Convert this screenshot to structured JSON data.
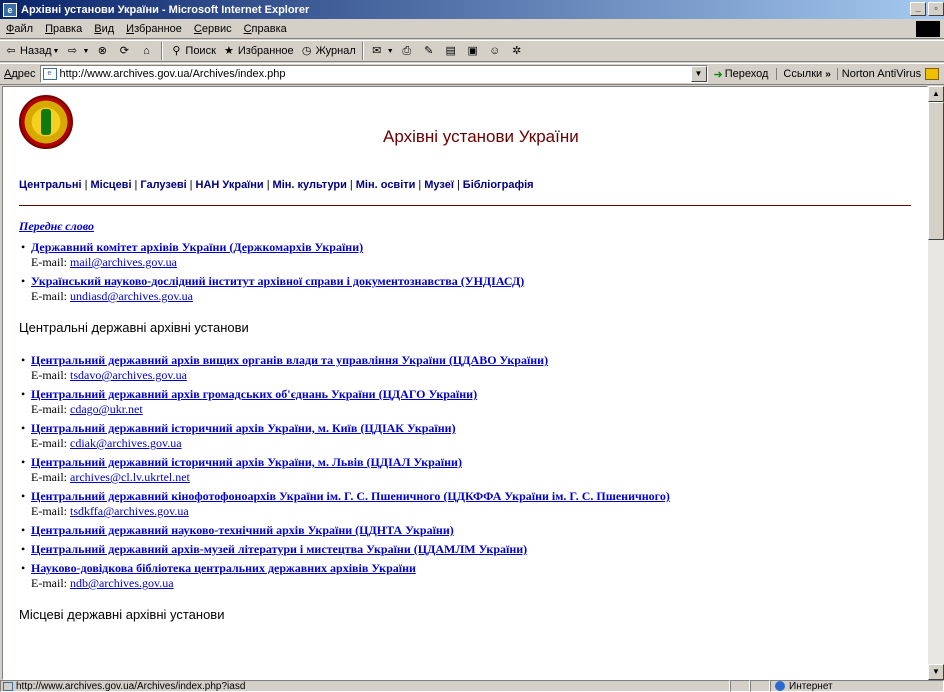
{
  "window": {
    "title": "Архівні установи України - Microsoft Internet Explorer"
  },
  "menu": [
    "Файл",
    "Правка",
    "Вид",
    "Избранное",
    "Сервис",
    "Справка"
  ],
  "toolbar": {
    "back": "Назад",
    "search": "Поиск",
    "favorites": "Избранное",
    "history": "Журнал"
  },
  "address": {
    "label": "Адрес",
    "url": "http://www.archives.gov.ua/Archives/index.php",
    "go": "Переход",
    "links": "Ссылки",
    "norton": "Norton AntiVirus"
  },
  "status": {
    "url": "http://www.archives.gov.ua/Archives/index.php?iasd",
    "zone": "Интернет"
  },
  "page": {
    "title": "Архівні установи України",
    "nav": [
      "Центральні",
      "Місцеві",
      "Галузеві",
      "НАН України",
      "Мін. культури",
      "Мін. освіти",
      "Музеї",
      "Бібліографія"
    ],
    "foreword": "Переднє слово",
    "email_label": "E-mail:",
    "top_items": [
      {
        "name": "Державний комітет архівів України (Держкомархів України)",
        "email": "mail@archives.gov.ua"
      },
      {
        "name": "Український науково-дослідний інститут архівної справи і документознавства (УНДІАСД)",
        "email": "undiasd@archives.gov.ua"
      }
    ],
    "central_heading": "Центральні державні архівні установи",
    "central_items": [
      {
        "name": "Центральний державний архів вищих органів влади та управління України (ЦДАВО України)",
        "email": "tsdavo@archives.gov.ua"
      },
      {
        "name": "Центральний державний архів громадських об'єднань України (ЦДАГО України)",
        "email": "cdago@ukr.net"
      },
      {
        "name": "Центральний державний історичний архів України, м. Київ (ЦДІАК України)",
        "email": "cdiak@archives.gov.ua"
      },
      {
        "name": "Центральний державний історичний архів України, м. Львів (ЦДІАЛ України)",
        "email": "archives@cl.lv.ukrtel.net"
      },
      {
        "name": "Центральний державний кінофотофоноархів України ім. Г. С. Пшеничного (ЦДКФФА України ім. Г. С. Пшеничного)",
        "email": "tsdkffa@archives.gov.ua"
      },
      {
        "name": "Центральний державний науково-технічний архів України (ЦДНТА України)",
        "email": ""
      },
      {
        "name": "Центральний державний архів-музей літератури і мистецтва України (ЦДАМЛМ України)",
        "email": ""
      },
      {
        "name": "Науково-довідкова бібліотека центральних державних архівів України",
        "email": "ndb@archives.gov.ua"
      }
    ],
    "local_heading": "Місцеві державні архівні установи"
  }
}
